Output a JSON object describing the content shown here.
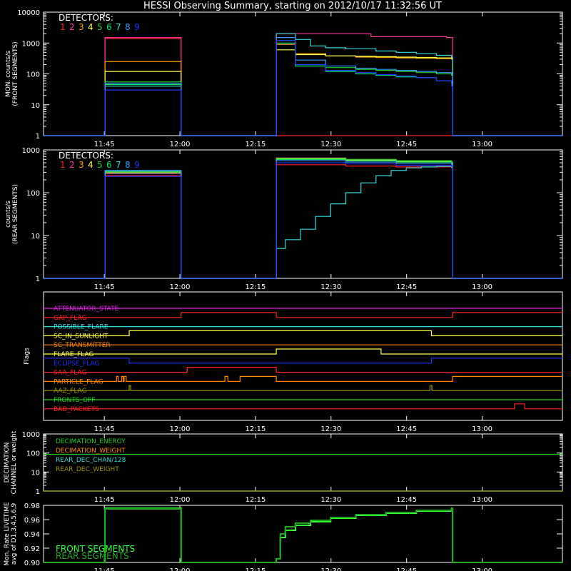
{
  "title": "HESSI Observing Summary, starting on 2012/10/17 11:32:56 UT",
  "colors": {
    "det": [
      "#ff2222",
      "#ff3399",
      "#ffa500",
      "#ffff44",
      "#22cc22",
      "#00ee66",
      "#33dddd",
      "#3399ff",
      "#2233ff"
    ],
    "axis": "#ffffff"
  },
  "time_ticks": [
    "11:45",
    "12:00",
    "12:15",
    "12:30",
    "12:45",
    "13:00"
  ],
  "time_tick_minutes": [
    12.07,
    27.07,
    42.07,
    57.07,
    72.07,
    87.07
  ],
  "time_range_minutes": [
    0,
    103
  ],
  "chart_data": [
    {
      "type": "line",
      "panel": "front",
      "ylabel": "MON. counts/s\n(FRONT SEGMENTS)",
      "ylabel_lines": [
        "MON. counts/s",
        "(FRONT SEGMENTS)"
      ],
      "yscale": "log",
      "ylim": [
        1,
        10000
      ],
      "yticks": [
        "1",
        "10",
        "100",
        "1000",
        "10000"
      ],
      "legend_title": "DETECTORS:",
      "legend_labels": [
        "1",
        "2",
        "3",
        "4",
        "5",
        "6",
        "7",
        "8",
        "9"
      ],
      "series": [
        {
          "name": "1",
          "x": [
            0,
            12,
            12.2,
            27,
            27.3,
            103
          ],
          "y": [
            1,
            1,
            1400,
            1400,
            1,
            1
          ]
        },
        {
          "name": "2",
          "x": [
            0,
            12,
            12.2,
            27,
            27.3,
            46,
            46.2,
            65,
            80,
            81,
            81.2,
            103
          ],
          "y": [
            1,
            1,
            1500,
            1500,
            1,
            1,
            2000,
            1600,
            1500,
            1500,
            1,
            1
          ]
        },
        {
          "name": "3",
          "x": [
            0,
            12,
            12.2,
            27,
            27.3,
            46,
            46.2,
            50,
            56,
            62,
            66,
            70,
            74,
            78,
            81,
            81.2,
            103
          ],
          "y": [
            1,
            1,
            250,
            250,
            1,
            1,
            900,
            450,
            380,
            350,
            340,
            330,
            320,
            310,
            300,
            1,
            1
          ]
        },
        {
          "name": "4",
          "x": [
            0,
            12,
            12.2,
            27,
            27.3,
            46,
            46.2,
            50,
            56,
            62,
            66,
            70,
            74,
            78,
            81,
            81.2,
            103
          ],
          "y": [
            1,
            1,
            120,
            120,
            1,
            1,
            600,
            420,
            380,
            370,
            360,
            350,
            340,
            330,
            320,
            1,
            1
          ]
        },
        {
          "name": "5",
          "x": [
            0,
            12,
            12.2,
            27,
            27.3,
            46,
            46.2,
            50,
            56,
            62,
            66,
            70,
            74,
            78,
            81,
            81.2,
            103
          ],
          "y": [
            1,
            1,
            55,
            55,
            1,
            1,
            1200,
            200,
            160,
            140,
            130,
            120,
            110,
            100,
            90,
            1,
            1
          ]
        },
        {
          "name": "6",
          "x": [
            0,
            12,
            12.2,
            27,
            27.3,
            46,
            46.2,
            50,
            56,
            62,
            66,
            70,
            74,
            78,
            81,
            81.2,
            103
          ],
          "y": [
            1,
            1,
            45,
            45,
            1,
            1,
            1000,
            180,
            120,
            100,
            90,
            80,
            75,
            60,
            50,
            1,
            1
          ]
        },
        {
          "name": "7",
          "x": [
            0,
            12,
            12.2,
            27,
            27.3,
            46,
            46.2,
            50,
            53,
            56,
            60,
            66,
            70,
            74,
            78,
            81,
            81.2,
            103
          ],
          "y": [
            1,
            1,
            40,
            40,
            1,
            1,
            2000,
            1300,
            800,
            700,
            650,
            550,
            500,
            450,
            400,
            350,
            1,
            1
          ]
        },
        {
          "name": "8",
          "x": [
            0,
            12,
            12.2,
            27,
            27.3,
            46,
            46.2,
            50,
            56,
            62,
            66,
            70,
            74,
            78,
            81,
            81.2,
            103
          ],
          "y": [
            1,
            1,
            50,
            50,
            1,
            1,
            1500,
            280,
            180,
            150,
            140,
            130,
            120,
            110,
            100,
            1,
            1
          ]
        },
        {
          "name": "9",
          "x": [
            0,
            12,
            12.2,
            27,
            27.3,
            46,
            46.2,
            50,
            56,
            62,
            66,
            70,
            74,
            78,
            81,
            81.2,
            103
          ],
          "y": [
            1,
            1,
            30,
            30,
            1,
            1,
            1200,
            200,
            130,
            110,
            95,
            85,
            75,
            60,
            40,
            1,
            1
          ]
        }
      ]
    },
    {
      "type": "line",
      "panel": "rear",
      "ylabel": "counts/s\n(REAR SEGMENTS)",
      "ylabel_lines": [
        "counts/s",
        "(REAR SEGMENTS)"
      ],
      "yscale": "log",
      "ylim": [
        1,
        1000
      ],
      "yticks": [
        "1",
        "10",
        "100",
        "1000"
      ],
      "legend_title": "DETECTORS:",
      "legend_labels": [
        "1",
        "2",
        "3",
        "4",
        "5",
        "6",
        "7",
        "8",
        "9"
      ],
      "series": [
        {
          "name": "1",
          "x": [
            0,
            12,
            12.2,
            27,
            27.3,
            46,
            46.2,
            60,
            70,
            81,
            81.2,
            103
          ],
          "y": [
            1,
            1,
            250,
            250,
            1,
            1,
            450,
            420,
            400,
            380,
            1,
            1
          ]
        },
        {
          "name": "2",
          "x": [
            0,
            12,
            12.2,
            27,
            27.3,
            46,
            46.2,
            60,
            70,
            81,
            81.2,
            103
          ],
          "y": [
            1,
            1,
            280,
            280,
            1,
            1,
            650,
            600,
            560,
            520,
            1,
            1
          ]
        },
        {
          "name": "3",
          "x": [
            0,
            12,
            12.2,
            27,
            27.3,
            46,
            46.2,
            60,
            70,
            81,
            81.2,
            103
          ],
          "y": [
            1,
            1,
            300,
            300,
            1,
            1,
            600,
            560,
            520,
            480,
            1,
            1
          ]
        },
        {
          "name": "4",
          "x": [
            0,
            12,
            12.2,
            27,
            27.3,
            46,
            46.2,
            60,
            70,
            81,
            81.2,
            103
          ],
          "y": [
            1,
            1,
            320,
            320,
            1,
            1,
            620,
            580,
            540,
            500,
            1,
            1
          ]
        },
        {
          "name": "5",
          "x": [
            0,
            12,
            12.2,
            27,
            27.3,
            46,
            46.2,
            60,
            70,
            81,
            81.2,
            103
          ],
          "y": [
            1,
            1,
            310,
            310,
            1,
            1,
            640,
            600,
            560,
            510,
            1,
            1
          ]
        },
        {
          "name": "6",
          "x": [
            0,
            12,
            12.2,
            27,
            27.3,
            46,
            46.2,
            60,
            70,
            81,
            81.2,
            103
          ],
          "y": [
            1,
            1,
            290,
            290,
            1,
            1,
            600,
            560,
            520,
            470,
            1,
            1
          ]
        },
        {
          "name": "7",
          "x": [
            0,
            12,
            12.2,
            27,
            27.3,
            46,
            46.2,
            48,
            51,
            54,
            57,
            60,
            63,
            66,
            69,
            72,
            75,
            78,
            81,
            81.2,
            103
          ],
          "y": [
            1,
            1,
            320,
            320,
            1,
            1,
            5,
            8,
            14,
            28,
            55,
            100,
            170,
            250,
            330,
            380,
            400,
            410,
            400,
            1,
            1
          ]
        },
        {
          "name": "8",
          "x": [
            0,
            12,
            12.2,
            27,
            27.3,
            46,
            46.2,
            60,
            70,
            81,
            81.2,
            103
          ],
          "y": [
            1,
            1,
            330,
            330,
            1,
            1,
            560,
            520,
            490,
            460,
            1,
            1
          ]
        },
        {
          "name": "9",
          "x": [
            0,
            12,
            12.2,
            27,
            27.3,
            46,
            46.2,
            60,
            70,
            81,
            81.2,
            103
          ],
          "y": [
            1,
            1,
            240,
            240,
            1,
            1,
            500,
            470,
            440,
            420,
            1,
            1
          ]
        }
      ]
    },
    {
      "type": "line",
      "panel": "flags",
      "ylabel": "Flags",
      "flags": [
        {
          "name": "ATTENUATOR_STATE",
          "color": "#dd22dd",
          "segments": [
            [
              0,
              103,
              0
            ]
          ]
        },
        {
          "name": "GAP_FLAG",
          "color": "#ff2222",
          "segments": [
            [
              0,
              27.3,
              0
            ],
            [
              27.3,
              46.2,
              1
            ],
            [
              46.2,
              81.2,
              0
            ],
            [
              81.2,
              103,
              1
            ]
          ]
        },
        {
          "name": "POSSIBLE_FLARE",
          "color": "#33dddd",
          "segments": [
            [
              0,
              103,
              0
            ]
          ]
        },
        {
          "name": "SC_IN_SUNLIGHT",
          "color": "#ffff44",
          "segments": [
            [
              0,
              17,
              0
            ],
            [
              17,
              77,
              1
            ],
            [
              77,
              103,
              0
            ]
          ]
        },
        {
          "name": "SC_TRANSMITTER",
          "color": "#ff8800",
          "segments": [
            [
              0,
              103,
              0
            ]
          ]
        },
        {
          "name": "FLARE_FLAG",
          "color": "#ffff44",
          "segments": [
            [
              0,
              46.2,
              0
            ],
            [
              46.2,
              67,
              1
            ],
            [
              67,
              103,
              0
            ]
          ]
        },
        {
          "name": "ECLIPSE_FLAG",
          "color": "#2233ff",
          "segments": [
            [
              0,
              17,
              1
            ],
            [
              17,
              77,
              0
            ],
            [
              77,
              103,
              1
            ]
          ]
        },
        {
          "name": "SAA_FLAG",
          "color": "#ff2222",
          "segments": [
            [
              0,
              28.5,
              0
            ],
            [
              28.5,
              46.2,
              1
            ],
            [
              46.2,
              103,
              0
            ]
          ]
        },
        {
          "name": "PARTICLE_FLAG",
          "color": "#ff8800",
          "segments": [
            [
              0,
              14.5,
              0
            ],
            [
              14.5,
              14.8,
              1
            ],
            [
              14.8,
              15.5,
              0
            ],
            [
              15.5,
              15.8,
              1
            ],
            [
              15.8,
              16,
              0
            ],
            [
              16,
              16.4,
              1
            ],
            [
              16.4,
              36,
              0
            ],
            [
              36,
              36.6,
              1
            ],
            [
              36.6,
              39,
              0
            ],
            [
              39,
              46.2,
              1
            ],
            [
              46.2,
              81.2,
              0
            ],
            [
              81.2,
              103,
              1
            ]
          ]
        },
        {
          "name": "AAZ_FLAG",
          "color": "#999900",
          "segments": [
            [
              0,
              17,
              0
            ],
            [
              17,
              17.3,
              1
            ],
            [
              17.3,
              76.7,
              0
            ],
            [
              76.7,
              77.1,
              1
            ],
            [
              77.1,
              103,
              0
            ]
          ]
        },
        {
          "name": "FRONTS_OFF",
          "color": "#22cc22",
          "segments": [
            [
              0,
              103,
              0
            ]
          ]
        },
        {
          "name": "BAD_PACKETS",
          "color": "#ff2222",
          "segments": [
            [
              0,
              93.5,
              0
            ],
            [
              93.5,
              95.5,
              1
            ],
            [
              95.5,
              103,
              0
            ]
          ]
        }
      ]
    },
    {
      "type": "line",
      "panel": "decimation",
      "ylabel": "DECIMATION\nCHANNEL or weight",
      "ylabel_lines": [
        "DECIMATION",
        "CHANNEL or weight"
      ],
      "yscale": "log",
      "ylim": [
        1,
        1000
      ],
      "yticks": [
        "1",
        "10",
        "100",
        "1000"
      ],
      "series": [
        {
          "name": "DECIMATION_ENERGY",
          "color": "#22cc22",
          "x": [
            0,
            103
          ],
          "y": [
            85,
            85
          ]
        },
        {
          "name": "DECIMATION_WEIGHT",
          "color": "#ff8800",
          "x": [
            0,
            103
          ],
          "y": [
            1,
            1
          ]
        },
        {
          "name": "REAR_DEC_CHAN/128",
          "color": "#33dddd",
          "x": [
            0,
            103
          ],
          "y": [
            1,
            1
          ]
        },
        {
          "name": "REAR_DEC_WEIGHT",
          "color": "#999900",
          "x": [
            0,
            103
          ],
          "y": [
            1,
            1
          ]
        }
      ]
    },
    {
      "type": "line",
      "panel": "livetime",
      "ylabel": "Mon. Rate LIVETIME\navg of D1,3,4,5,6,9",
      "ylabel_lines": [
        "Mon. Rate LIVETIME",
        "avg of D1,3,4,5,6,9"
      ],
      "ylim": [
        0.9,
        0.98
      ],
      "yticks": [
        "0.90",
        "0.92",
        "0.94",
        "0.96",
        "0.98"
      ],
      "series": [
        {
          "name": "FRONT SEGMENTS",
          "color": "#33ff33",
          "x": [
            0,
            12,
            12.2,
            27,
            27.3,
            46,
            46.2,
            47,
            48,
            50,
            53,
            57,
            62,
            68,
            74,
            81,
            81.2,
            103
          ],
          "y": [
            0.9,
            0.9,
            0.976,
            0.976,
            0.9,
            0.9,
            0.905,
            0.935,
            0.945,
            0.952,
            0.957,
            0.962,
            0.966,
            0.969,
            0.972,
            0.975,
            0.9,
            0.9
          ]
        },
        {
          "name": "REAR SEGMENTS",
          "color": "#22aa22",
          "x": [
            0,
            12,
            12.2,
            27,
            27.3,
            46,
            46.2,
            47,
            48,
            50,
            53,
            57,
            62,
            68,
            74,
            81,
            81.2,
            103
          ],
          "y": [
            0.9,
            0.9,
            0.975,
            0.975,
            0.9,
            0.9,
            0.905,
            0.94,
            0.95,
            0.955,
            0.959,
            0.963,
            0.967,
            0.97,
            0.973,
            0.976,
            0.9,
            0.9
          ]
        }
      ]
    }
  ]
}
